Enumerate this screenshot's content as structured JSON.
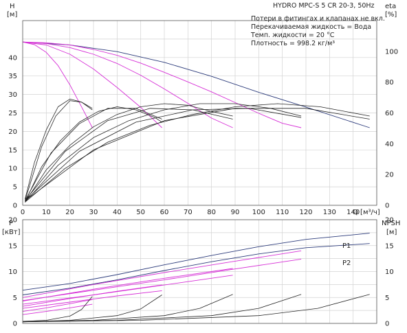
{
  "title": "HYDRO MPC-S 5 CR 20-3, 50Hz",
  "info": [
    "Потери в фитингах и клапанах не вкл.",
    "Перекачиваемая жидкость = Вода",
    "Темп. жидкости = 20 °C",
    "Плотность = 998.2 кг/м³"
  ],
  "colors": {
    "head": "#2b3a7a",
    "pump": "#d62ed6",
    "eta": "#222222",
    "grid": "#d2d2d2"
  },
  "chart_data": [
    {
      "type": "line",
      "id": "head-efficiency",
      "xlabel": "Q [м³/ч]",
      "ylabel_left": [
        "H",
        "[м]"
      ],
      "ylabel_right": [
        "eta",
        "[%]"
      ],
      "xlim": [
        0,
        150
      ],
      "ylim": [
        0,
        50
      ],
      "y2lim": [
        0,
        120
      ],
      "x_ticks": [
        "0",
        "10",
        "20",
        "30",
        "40",
        "50",
        "60",
        "70",
        "80",
        "90",
        "100",
        "110",
        "120",
        "130",
        "140",
        "Q [м³/ч]"
      ],
      "y_ticks": [
        "0",
        "5",
        "10",
        "15",
        "20",
        "25",
        "30",
        "35",
        "40"
      ],
      "y2_ticks": [
        "0",
        "20",
        "40",
        "60",
        "80",
        "100"
      ],
      "grid": true,
      "series_head": [
        {
          "kind": "system",
          "x": [
            0,
            20,
            40,
            60,
            80,
            100,
            120,
            147
          ],
          "y": [
            44.2,
            43.4,
            41.6,
            38.7,
            34.9,
            30.6,
            26.6,
            21.0
          ]
        },
        {
          "kind": "pump",
          "x": [
            0,
            10,
            20,
            30,
            40,
            50,
            60,
            70,
            80,
            90,
            100,
            110,
            118
          ],
          "y": [
            44.2,
            44.0,
            43.4,
            42.2,
            40.6,
            38.5,
            36.0,
            33.4,
            30.7,
            27.8,
            24.9,
            22.2,
            21.0
          ]
        },
        {
          "kind": "pump",
          "x": [
            0,
            10,
            20,
            30,
            40,
            50,
            60,
            70,
            80,
            89
          ],
          "y": [
            44.2,
            43.8,
            42.7,
            40.9,
            38.4,
            35.2,
            31.5,
            27.6,
            23.6,
            21.0
          ]
        },
        {
          "kind": "pump",
          "x": [
            0,
            10,
            20,
            30,
            40,
            50,
            59
          ],
          "y": [
            44.2,
            43.4,
            40.9,
            36.9,
            31.9,
            26.5,
            21.0
          ]
        },
        {
          "kind": "pump",
          "x": [
            0,
            5,
            10,
            15,
            20,
            25,
            29.5
          ],
          "y": [
            44.2,
            43.5,
            41.4,
            37.8,
            32.6,
            26.6,
            21.0
          ]
        }
      ],
      "series_eta": [
        {
          "x": [
            1,
            5,
            10,
            15,
            20,
            25,
            29.5
          ],
          "y": [
            4,
            28,
            49,
            64,
            69,
            67,
            62
          ]
        },
        {
          "x": [
            1,
            8,
            16,
            24,
            32,
            40,
            48,
            56,
            59
          ],
          "y": [
            2,
            25,
            42,
            54,
            61,
            64,
            62,
            57,
            54
          ]
        },
        {
          "x": [
            1,
            10,
            20,
            30,
            40,
            50,
            60,
            70,
            80,
            89
          ],
          "y": [
            2,
            23,
            39,
            51,
            59,
            64,
            66,
            65,
            61,
            58
          ]
        },
        {
          "x": [
            1,
            15,
            30,
            45,
            60,
            75,
            90,
            105,
            118
          ],
          "y": [
            2,
            26,
            44,
            55,
            62,
            66,
            66,
            63,
            58
          ]
        },
        {
          "x": [
            1,
            18,
            36,
            54,
            72,
            90,
            108,
            126,
            147
          ],
          "y": [
            2,
            24,
            41,
            52,
            59,
            64,
            66,
            64,
            58
          ]
        },
        {
          "x": [
            1,
            8,
            14,
            20,
            25,
            29.5
          ],
          "y": [
            3,
            38,
            58,
            68,
            67,
            63
          ]
        },
        {
          "x": [
            1,
            12,
            24,
            36,
            48,
            59
          ],
          "y": [
            3,
            34,
            53,
            63,
            63,
            56
          ]
        },
        {
          "x": [
            1,
            18,
            36,
            54,
            72,
            89
          ],
          "y": [
            3,
            35,
            55,
            63,
            62,
            56
          ]
        },
        {
          "x": [
            1,
            24,
            48,
            72,
            96,
            118
          ],
          "y": [
            3,
            35,
            54,
            62,
            63,
            57
          ]
        },
        {
          "x": [
            1,
            30,
            60,
            90,
            120,
            147
          ],
          "y": [
            3,
            36,
            55,
            63,
            63,
            56
          ]
        }
      ]
    },
    {
      "type": "line",
      "id": "power-npsh",
      "ylabel_left": [
        "P",
        "[кВт]"
      ],
      "ylabel_right": [
        "NPSH",
        "[м]"
      ],
      "xlim": [
        0,
        150
      ],
      "ylim": [
        0,
        20
      ],
      "y2lim": [
        0,
        20
      ],
      "y_ticks": [
        "0",
        "5",
        "10",
        "15",
        "20"
      ],
      "y2_ticks": [
        "0",
        "5",
        "10",
        "15",
        "20"
      ],
      "grid": true,
      "p1_label": "P1",
      "p2_label": "P2",
      "series_power": [
        {
          "kind": "P1",
          "x": [
            0,
            20,
            40,
            60,
            80,
            100,
            120,
            147
          ],
          "y": [
            6.4,
            7.7,
            9.4,
            11.3,
            13.1,
            14.8,
            16.2,
            17.4
          ]
        },
        {
          "kind": "P2",
          "x": [
            0,
            20,
            40,
            60,
            80,
            100,
            120,
            147
          ],
          "y": [
            5.5,
            6.8,
            8.4,
            10.2,
            11.9,
            13.4,
            14.6,
            15.4
          ]
        },
        {
          "kind": "pump",
          "x": [
            0,
            30,
            60,
            90,
            118
          ],
          "y": [
            5.0,
            7.5,
            9.8,
            12.0,
            14.0
          ]
        },
        {
          "kind": "pump",
          "x": [
            0,
            30,
            60,
            90,
            118
          ],
          "y": [
            4.4,
            6.4,
            8.4,
            10.5,
            12.4
          ]
        },
        {
          "kind": "pump",
          "x": [
            0,
            30,
            60,
            89
          ],
          "y": [
            4.3,
            6.6,
            8.7,
            10.6
          ]
        },
        {
          "kind": "pump",
          "x": [
            0,
            30,
            60,
            89
          ],
          "y": [
            3.7,
            5.5,
            7.4,
            9.3
          ]
        },
        {
          "kind": "pump",
          "x": [
            0,
            20,
            40,
            59
          ],
          "y": [
            3.3,
            4.8,
            6.2,
            7.4
          ]
        },
        {
          "kind": "pump",
          "x": [
            0,
            20,
            40,
            59
          ],
          "y": [
            2.9,
            4.1,
            5.3,
            6.3
          ]
        },
        {
          "kind": "pump",
          "x": [
            0,
            10,
            20,
            29.5
          ],
          "y": [
            2.3,
            3.0,
            3.8,
            4.6
          ]
        },
        {
          "kind": "pump",
          "x": [
            0,
            10,
            20,
            29.5
          ],
          "y": [
            1.7,
            2.3,
            3.0,
            3.7
          ]
        }
      ],
      "series_npsh": [
        {
          "x": [
            0,
            10,
            20,
            25,
            29.5
          ],
          "y": [
            0.4,
            0.6,
            1.4,
            2.7,
            5.2
          ]
        },
        {
          "x": [
            0,
            20,
            40,
            50,
            59
          ],
          "y": [
            0.3,
            0.6,
            1.5,
            2.8,
            5.5
          ]
        },
        {
          "x": [
            0,
            30,
            60,
            75,
            89
          ],
          "y": [
            0.3,
            0.6,
            1.5,
            2.9,
            5.6
          ]
        },
        {
          "x": [
            0,
            40,
            80,
            100,
            118
          ],
          "y": [
            0.3,
            0.6,
            1.5,
            2.9,
            5.6
          ]
        },
        {
          "x": [
            0,
            50,
            100,
            125,
            147
          ],
          "y": [
            0.3,
            0.6,
            1.5,
            2.9,
            5.6
          ]
        }
      ]
    }
  ]
}
